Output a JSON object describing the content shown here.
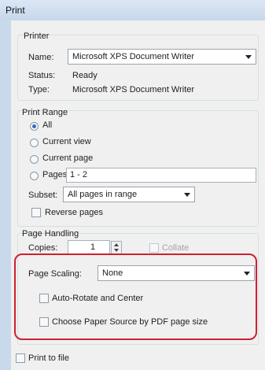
{
  "window": {
    "title": "Print"
  },
  "printer": {
    "group_label": "Printer",
    "name_label": "Name:",
    "name_value": "Microsoft XPS Document Writer",
    "status_label": "Status:",
    "status_value": "Ready",
    "type_label": "Type:",
    "type_value": "Microsoft XPS Document Writer"
  },
  "print_range": {
    "group_label": "Print Range",
    "all": "All",
    "current_view": "Current view",
    "current_page": "Current page",
    "pages": "Pages",
    "pages_value": "1 - 2",
    "subset_label": "Subset:",
    "subset_value": "All pages in range",
    "reverse_pages": "Reverse pages",
    "selected": "All"
  },
  "page_handling": {
    "group_label": "Page Handling",
    "copies_label": "Copies:",
    "copies_value": "1",
    "collate": "Collate",
    "page_scaling_label": "Page Scaling:",
    "page_scaling_value": "None",
    "auto_rotate": "Auto-Rotate and Center",
    "choose_paper_source": "Choose Paper Source by PDF page size"
  },
  "print_to_file": "Print to file",
  "colors": {
    "highlight": "#cf2030",
    "selected_radio": "#2d6fbd"
  }
}
